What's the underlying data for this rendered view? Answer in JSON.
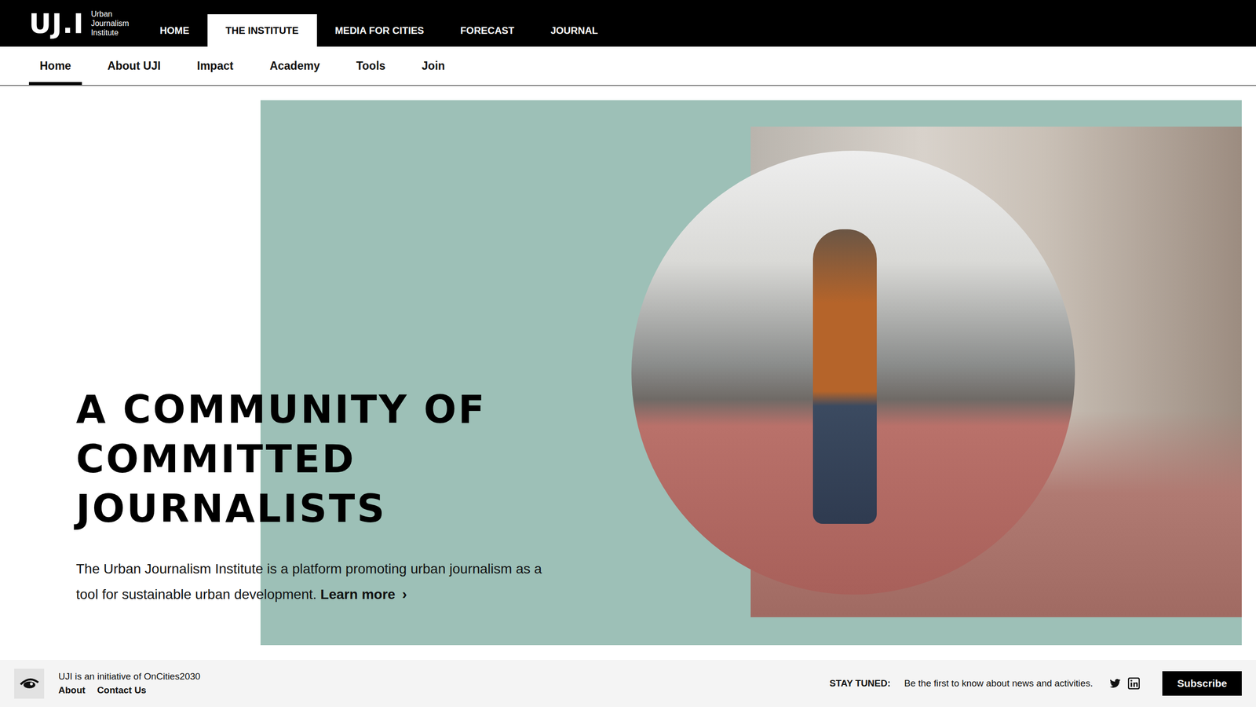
{
  "logo": {
    "mark": "UJ.I",
    "lines": [
      "Urban",
      "Journalism",
      "Institute"
    ]
  },
  "main_nav": [
    {
      "label": "HOME",
      "selected": false
    },
    {
      "label": "THE INSTITUTE",
      "selected": true
    },
    {
      "label": "MEDIA FOR CITIES",
      "selected": false
    },
    {
      "label": "FORECAST",
      "selected": false
    },
    {
      "label": "JOURNAL",
      "selected": false
    }
  ],
  "sub_nav": [
    {
      "label": "Home",
      "selected": true
    },
    {
      "label": "About UJI",
      "selected": false
    },
    {
      "label": "Impact",
      "selected": false
    },
    {
      "label": "Academy",
      "selected": false
    },
    {
      "label": "Tools",
      "selected": false
    },
    {
      "label": "Join",
      "selected": false
    }
  ],
  "hero": {
    "heading_lines": [
      "A COMMUNITY OF",
      "COMMITTED",
      "JOURNALISTS"
    ],
    "text": "The Urban Journalism Institute is a platform promoting urban journalism as a tool for sustainable urban development.",
    "link": "Learn more",
    "link_icon": "›"
  },
  "footer": {
    "initiative": "UJI is an initiative of OnCities2030",
    "links": [
      "About",
      "Contact Us"
    ],
    "stay_tuned": "STAY TUNED:",
    "tagline": "Be the first to know about news and activities.",
    "subscribe": "Subscribe"
  }
}
